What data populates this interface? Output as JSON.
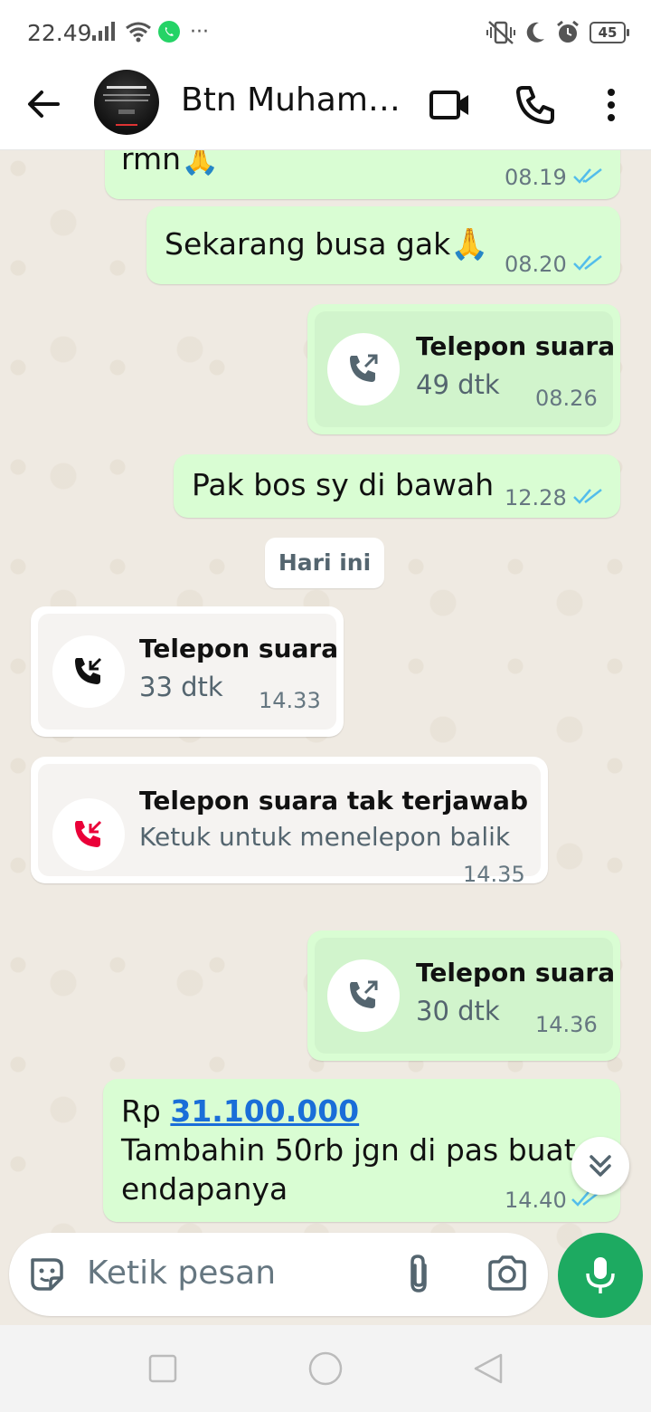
{
  "status_bar": {
    "time": "22.49",
    "battery": "45",
    "icons": [
      "signal-icon",
      "wifi-icon",
      "whatsapp-icon",
      "more-dots-icon",
      "vibrate-icon",
      "moon-icon",
      "alarm-icon",
      "battery-icon"
    ]
  },
  "header": {
    "contact_name": "Btn Muhamad...",
    "icons": [
      "back-arrow-icon",
      "video-call-icon",
      "phone-icon",
      "menu-dots-icon"
    ]
  },
  "messages": [
    {
      "type": "text",
      "direction": "out",
      "text": "rmn",
      "emoji": "🙏",
      "time": "08.19",
      "status": "read"
    },
    {
      "type": "text",
      "direction": "out",
      "text": "Sekarang busa gak",
      "emoji": "🙏",
      "time": "08.20",
      "status": "read"
    },
    {
      "type": "call",
      "direction": "out",
      "title": "Telepon suara",
      "subtitle": "49 dtk",
      "time": "08.26"
    },
    {
      "type": "text",
      "direction": "out",
      "text": "Pak bos sy di bawah",
      "time": "12.28",
      "status": "read"
    },
    {
      "type": "call",
      "direction": "in",
      "title": "Telepon suara",
      "subtitle": "33 dtk",
      "time": "14.33"
    },
    {
      "type": "call",
      "direction": "in",
      "missed": true,
      "title": "Telepon suara tak terjawab",
      "subtitle": "Ketuk untuk menelepon balik",
      "time": "14.35"
    },
    {
      "type": "call",
      "direction": "out",
      "title": "Telepon suara",
      "subtitle": "30 dtk",
      "time": "14.36"
    },
    {
      "type": "text",
      "direction": "out",
      "prefix": "Rp ",
      "link": "31.100.000",
      "line2": "Tambahin 50rb jgn di pas buat",
      "line3": "endapanya",
      "time": "14.40",
      "status": "read"
    }
  ],
  "date_chip": "Hari ini",
  "input": {
    "placeholder": "Ketik pesan"
  },
  "colors": {
    "outgoing_bubble": "#d9fdd3",
    "incoming_bubble": "#ffffff",
    "read_ticks": "#53bdeb",
    "missed_call": "#ea0038",
    "mic_button": "#1daa61",
    "link": "#1a6ed8"
  }
}
